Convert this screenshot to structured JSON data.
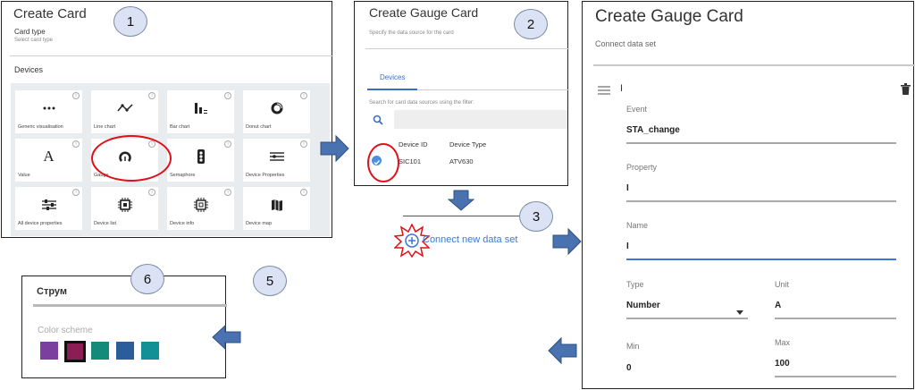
{
  "panel1": {
    "title": "Create Card",
    "card_type_label": "Card type",
    "card_type_sub": "Select card type",
    "devices_label": "Devices",
    "tiles": [
      {
        "label": "Generic visualisation",
        "icon": "ellipsis-icon"
      },
      {
        "label": "Line chart",
        "icon": "line-chart-icon"
      },
      {
        "label": "Bar chart",
        "icon": "bar-chart-icon"
      },
      {
        "label": "Donut chart",
        "icon": "donut-chart-icon"
      },
      {
        "label": "Value",
        "icon": "value-icon",
        "glyph": "A"
      },
      {
        "label": "Gauge",
        "icon": "gauge-icon"
      },
      {
        "label": "Semaphore",
        "icon": "semaphore-icon"
      },
      {
        "label": "Device Properties",
        "icon": "device-properties-icon"
      },
      {
        "label": "All device properties",
        "icon": "sliders-icon"
      },
      {
        "label": "Device list",
        "icon": "chip-icon"
      },
      {
        "label": "Device info",
        "icon": "chip-info-icon"
      },
      {
        "label": "Device map",
        "icon": "map-icon"
      }
    ],
    "info_glyph": "i"
  },
  "panel2": {
    "title": "Create Gauge Card",
    "subtitle": "Specify the data source for the card",
    "tab": "Devices",
    "filter_label": "Search for card data sources using the filter:",
    "columns": [
      "Device ID",
      "Device Type"
    ],
    "row": {
      "device_id": "SIC101",
      "device_type": "ATV630"
    }
  },
  "panel3": {
    "title": "Create Gauge Card",
    "subtitle": "Connect data set",
    "dataset_name": "I",
    "event_label": "Event",
    "event_value": "STA_change",
    "property_label": "Property",
    "property_value": "I",
    "name_label": "Name",
    "name_value": "I",
    "type_label": "Type",
    "type_value": "Number",
    "unit_label": "Unit",
    "unit_value": "A",
    "min_label": "Min",
    "min_value": "0",
    "max_label": "Max",
    "max_value": "100"
  },
  "connect_link": "Connect new data set",
  "panel6": {
    "title": "Струм",
    "color_scheme_label": "Color scheme",
    "swatches": [
      "#7b3fa0",
      "#8b1f55",
      "#138a7a",
      "#2b5d9a",
      "#139096"
    ]
  },
  "steps": [
    "1",
    "2",
    "3",
    "5",
    "6"
  ],
  "colors": {
    "accent": "#3a78d4",
    "highlight": "#e0101a",
    "arrow": "#4a72b0",
    "step_fill": "#dae2f3"
  }
}
